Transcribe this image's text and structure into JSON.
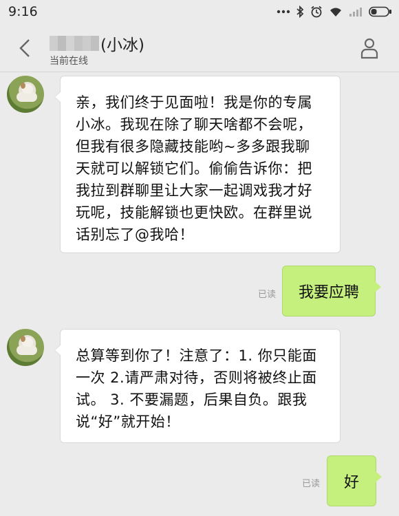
{
  "status_bar": {
    "time": "9:16"
  },
  "header": {
    "contact_name": "(小冰)",
    "contact_status": "当前在线"
  },
  "messages": [
    {
      "side": "left",
      "text": "亲，我们终于见面啦！我是你的专属小冰。我现在除了聊天啥都不会呢，但我有很多隐藏技能哟~多多跟我聊天就可以解锁它们。偷偷告诉你：把我拉到群聊里让大家一起调戏我才好玩呢，技能解锁也更快欧。在群里说话别忘了@我哈！"
    },
    {
      "side": "right",
      "text": "我要应聘",
      "read": "已读"
    },
    {
      "side": "left",
      "text": "总算等到你了！注意了：1. 你只能面一次 2.请严肃对待，否则将被终止面试。 3. 不要漏题，后果自负。跟我说“好”就开始！"
    },
    {
      "side": "right",
      "text": "好",
      "read": "已读"
    }
  ],
  "colors": {
    "background": "#ebebeb",
    "bubble_incoming": "#ffffff",
    "bubble_outgoing": "#c5f07e"
  },
  "icons": [
    "dots-icon",
    "bluetooth-icon",
    "alarm-icon",
    "wifi-icon",
    "signal-icon",
    "battery-icon",
    "back-arrow-icon",
    "person-icon"
  ]
}
